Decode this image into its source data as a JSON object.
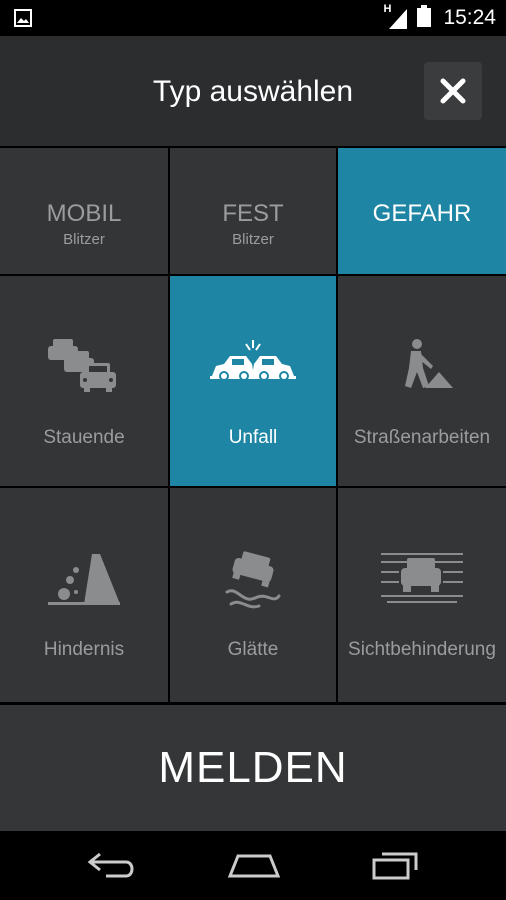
{
  "status_bar": {
    "time": "15:24",
    "network_label": "H",
    "icons": [
      "image-notification-icon",
      "signal-icon",
      "battery-icon"
    ]
  },
  "header": {
    "title": "Typ auswählen",
    "close_icon": "close-icon"
  },
  "tabs": [
    {
      "label": "MOBIL",
      "sub": "Blitzer",
      "selected": false
    },
    {
      "label": "FEST",
      "sub": "Blitzer",
      "selected": false
    },
    {
      "label": "GEFAHR",
      "sub": "",
      "selected": true
    }
  ],
  "hazards": [
    {
      "label": "Stauende",
      "icon": "traffic-jam-icon",
      "selected": false
    },
    {
      "label": "Unfall",
      "icon": "car-crash-icon",
      "selected": true
    },
    {
      "label": "Straßenarbeiten",
      "icon": "road-works-icon",
      "selected": false
    },
    {
      "label": "Hindernis",
      "icon": "falling-rocks-icon",
      "selected": false
    },
    {
      "label": "Glätte",
      "icon": "slippery-road-icon",
      "selected": false
    },
    {
      "label": "Sichtbehinderung",
      "icon": "fog-icon",
      "selected": false
    }
  ],
  "action": {
    "label": "MELDEN"
  },
  "nav": {
    "icons": [
      "back-icon",
      "home-icon",
      "recents-icon"
    ]
  },
  "colors": {
    "accent": "#1e86a4",
    "tile": "#333537",
    "header": "#2b2d2f",
    "inactive_text": "#9a9c9e"
  }
}
